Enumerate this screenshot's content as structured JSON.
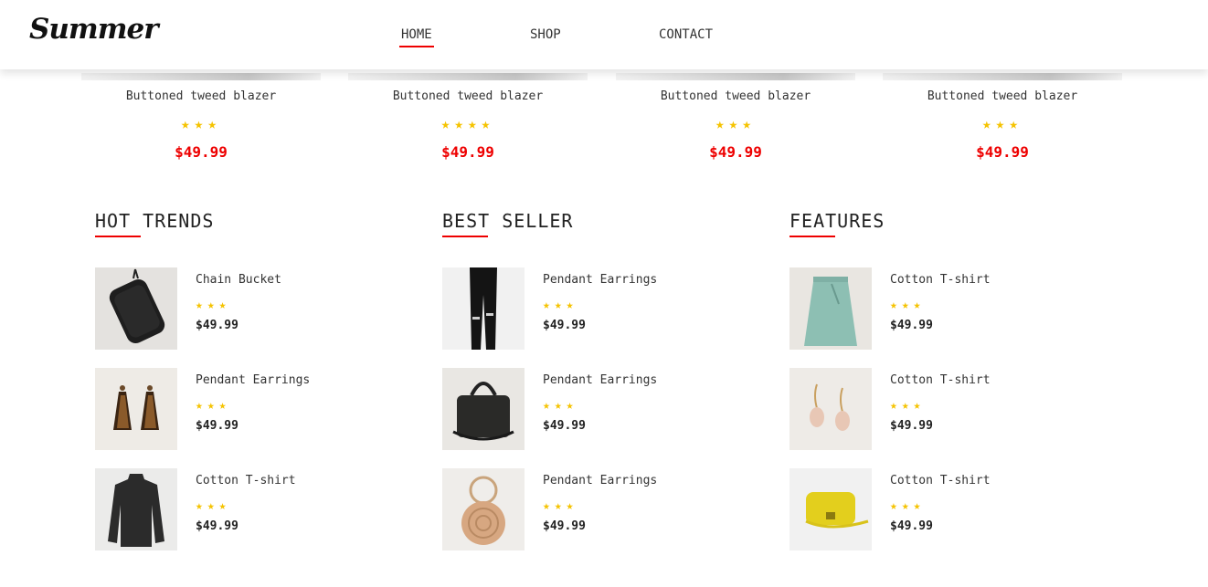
{
  "header": {
    "logo": "Summer",
    "nav": [
      {
        "label": "HOME",
        "active": true
      },
      {
        "label": "SHOP",
        "active": false
      },
      {
        "label": "CONTACT",
        "active": false
      }
    ]
  },
  "top_products": [
    {
      "name": "Buttoned tweed blazer",
      "rating": 3,
      "stars": "★★★",
      "price": "$49.99"
    },
    {
      "name": "Buttoned tweed blazer",
      "rating": 4,
      "stars": "★★★★",
      "price": "$49.99"
    },
    {
      "name": "Buttoned tweed blazer",
      "rating": 3,
      "stars": "★★★",
      "price": "$49.99"
    },
    {
      "name": "Buttoned tweed blazer",
      "rating": 3,
      "stars": "★★★",
      "price": "$49.99"
    }
  ],
  "sections": [
    {
      "title": "HOT TRENDS",
      "items": [
        {
          "name": "Chain Bucket",
          "rating": 3,
          "stars": "★★★",
          "price": "$49.99",
          "image": "black-bag-image"
        },
        {
          "name": "Pendant Earrings",
          "rating": 3,
          "stars": "★★★",
          "price": "$49.99",
          "image": "tassel-earrings-image"
        },
        {
          "name": "Cotton T-shirt",
          "rating": 3,
          "stars": "★★★",
          "price": "$49.99",
          "image": "black-sweater-image"
        }
      ]
    },
    {
      "title": "BEST SELLER",
      "items": [
        {
          "name": "Pendant Earrings",
          "rating": 3,
          "stars": "★★★",
          "price": "$49.99",
          "image": "black-jeans-image"
        },
        {
          "name": "Pendant Earrings",
          "rating": 3,
          "stars": "★★★",
          "price": "$49.99",
          "image": "leather-bag-image"
        },
        {
          "name": "Pendant Earrings",
          "rating": 3,
          "stars": "★★★",
          "price": "$49.99",
          "image": "round-straw-bag-image"
        }
      ]
    },
    {
      "title": "FEATURES",
      "items": [
        {
          "name": "Cotton T-shirt",
          "rating": 3,
          "stars": "★★★",
          "price": "$49.99",
          "image": "green-skirt-image"
        },
        {
          "name": "Cotton T-shirt",
          "rating": 3,
          "stars": "★★★",
          "price": "$49.99",
          "image": "shell-earrings-image"
        },
        {
          "name": "Cotton T-shirt",
          "rating": 3,
          "stars": "★★★",
          "price": "$49.99",
          "image": "yellow-bag-image"
        }
      ]
    }
  ],
  "colors": {
    "accent": "#e00000",
    "star": "#f5c300",
    "text": "#222222"
  }
}
